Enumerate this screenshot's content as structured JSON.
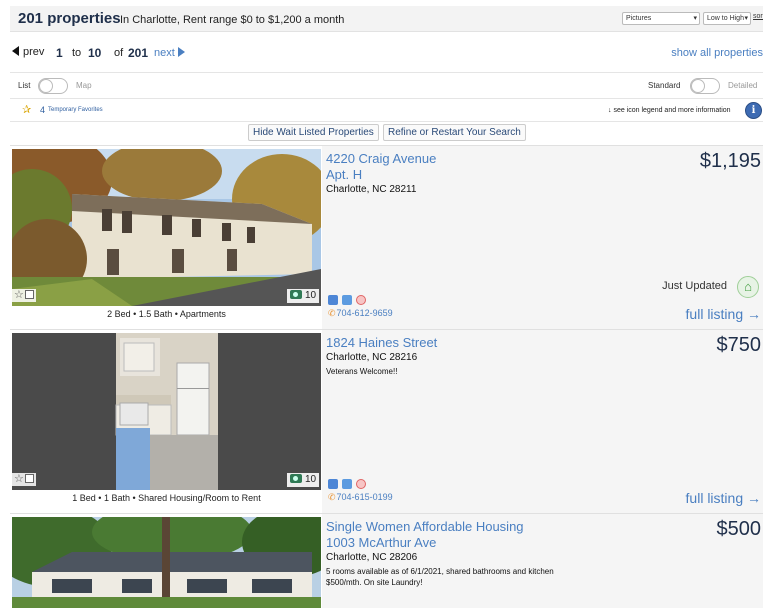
{
  "header": {
    "count": "201 properties",
    "range": "In Charlotte, Rent range $0 to $1,200 a month",
    "view_select": "Pictures",
    "sort_select": "Low to High",
    "sort_link": "sort"
  },
  "pager": {
    "prev": "prev",
    "from": "1",
    "to_word": "to",
    "to": "10",
    "of_word": "of",
    "total": "201",
    "next": "next",
    "show_all": "show all properties"
  },
  "toggles": {
    "list": "List",
    "map": "Map",
    "standard": "Standard",
    "detailed": "Detailed"
  },
  "favorites": {
    "count": "4",
    "label": "Temporary Favorites",
    "legend": "↓ see icon legend and more information",
    "info_icon": "info-icon"
  },
  "buttons": {
    "hide_wait": "Hide Wait Listed Properties",
    "refine": "Refine or Restart Your Search"
  },
  "listings": [
    {
      "address1": "4220 Craig Avenue",
      "address2": "Apt. H",
      "city": "Charlotte, NC  28211",
      "note": "",
      "price": "$1,195",
      "caption": "2 Bed • 1.5 Bath • Apartments",
      "photos": "10",
      "updated": "Just Updated",
      "phone": "704-612-9659",
      "full": "full listing →"
    },
    {
      "address1": "1824 Haines Street",
      "address2": "",
      "city": "Charlotte, NC  28216",
      "note": "Veterans Welcome!!",
      "price": "$750",
      "caption": "1 Bed • 1 Bath • Shared Housing/Room to Rent",
      "photos": "10",
      "updated": "",
      "phone": "704-615-0199",
      "full": "full listing →"
    },
    {
      "address1": "Single Women Affordable Housing",
      "address2": "1003 McArthur Ave",
      "city": "Charlotte, NC  28206",
      "note": "5 rooms available as of 6/1/2021, shared bathrooms and kitchen $500/mth. On site Laundry!",
      "price": "$500",
      "caption": "",
      "photos": "",
      "updated": "",
      "phone": "",
      "full": ""
    }
  ]
}
